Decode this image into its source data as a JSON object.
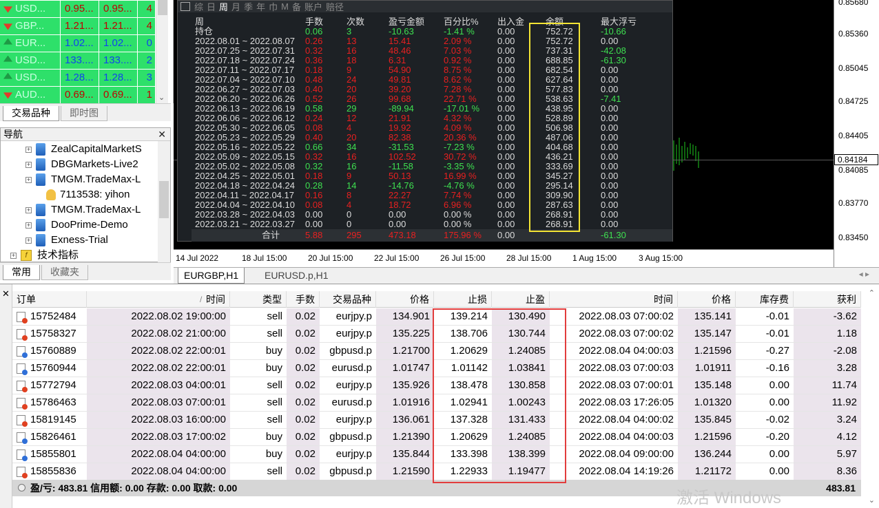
{
  "market_watch": {
    "rows": [
      {
        "symbol": "USD...",
        "bid": "0.95...",
        "ask": "0.95...",
        "spread": "4",
        "dir": "down",
        "bg": "#2ee06a"
      },
      {
        "symbol": "GBP...",
        "bid": "1.21...",
        "ask": "1.21...",
        "spread": "4",
        "dir": "down",
        "bg": "#2ee06a"
      },
      {
        "symbol": "EUR...",
        "bid": "1.02...",
        "ask": "1.02...",
        "spread": "0",
        "dir": "up",
        "bg": "#2ee06a"
      },
      {
        "symbol": "USD...",
        "bid": "133....",
        "ask": "133....",
        "spread": "2",
        "dir": "up",
        "bg": "#2ee06a"
      },
      {
        "symbol": "USD...",
        "bid": "1.28...",
        "ask": "1.28...",
        "spread": "3",
        "dir": "up",
        "bg": "#2ee06a"
      },
      {
        "symbol": "AUD...",
        "bid": "0.69...",
        "ask": "0.69...",
        "spread": "1",
        "dir": "down",
        "bg": "#2ee06a"
      }
    ],
    "tabs": [
      "交易品种",
      "即时图"
    ]
  },
  "navigator": {
    "title": "导航",
    "items": [
      {
        "label": "ZealCapitalMarketS",
        "kind": "server"
      },
      {
        "label": "DBGMarkets-Live2",
        "kind": "server"
      },
      {
        "label": "TMGM.TradeMax-L",
        "kind": "server"
      },
      {
        "label": "7113538: yihon",
        "kind": "user"
      },
      {
        "label": "TMGM.TradeMax-L",
        "kind": "server"
      },
      {
        "label": "DooPrime-Demo",
        "kind": "server"
      },
      {
        "label": "Exness-Trial",
        "kind": "server"
      },
      {
        "label": "技术指标",
        "kind": "indicator"
      }
    ],
    "tabs": [
      "常用",
      "收藏夹"
    ]
  },
  "chart": {
    "prices": [
      "0.85680",
      "0.85360",
      "0.85045",
      "0.84725",
      "0.84405",
      "0.84085",
      "0.83770",
      "0.83450"
    ],
    "current_price": "0.84184",
    "times": [
      "14 Jul 2022",
      "18 Jul 15:00",
      "20 Jul 15:00",
      "22 Jul 15:00",
      "26 Jul 15:00",
      "28 Jul 15:00",
      "1 Aug 15:00",
      "3 Aug 15:00"
    ],
    "tabs": [
      "EURGBP,H1",
      "EURUSD.p,H1"
    ]
  },
  "report": {
    "toolbar": [
      "综",
      "日",
      "周",
      "月",
      "季",
      "年",
      "巾",
      "M",
      "备",
      "账户",
      "赔径"
    ],
    "active_period": "周",
    "headers": {
      "period": "周",
      "lots": "手数",
      "count": "次数",
      "pnl": "盈亏金额",
      "pct": "百分比%",
      "flow": "出入金",
      "balance": "余额",
      "max_float": "最大浮亏"
    },
    "rows": [
      {
        "period": "持仓",
        "lots": "0.06",
        "count": "3",
        "pnl": "-10.63",
        "pct": "-1.41 %",
        "flow": "0.00",
        "balance": "752.72",
        "max_float": "-10.66",
        "sign": "neg"
      },
      {
        "period": "2022.08.01 ~ 2022.08.07",
        "lots": "0.26",
        "count": "13",
        "pnl": "15.41",
        "pct": "2.09 %",
        "flow": "0.00",
        "balance": "752.72",
        "max_float": "0.00",
        "sign": "pos"
      },
      {
        "period": "2022.07.25 ~ 2022.07.31",
        "lots": "0.32",
        "count": "16",
        "pnl": "48.46",
        "pct": "7.03 %",
        "flow": "0.00",
        "balance": "737.31",
        "max_float": "-42.08",
        "sign": "pos"
      },
      {
        "period": "2022.07.18 ~ 2022.07.24",
        "lots": "0.36",
        "count": "18",
        "pnl": "6.31",
        "pct": "0.92 %",
        "flow": "0.00",
        "balance": "688.85",
        "max_float": "-61.30",
        "sign": "pos"
      },
      {
        "period": "2022.07.11 ~ 2022.07.17",
        "lots": "0.18",
        "count": "9",
        "pnl": "54.90",
        "pct": "8.75 %",
        "flow": "0.00",
        "balance": "682.54",
        "max_float": "0.00",
        "sign": "pos"
      },
      {
        "period": "2022.07.04 ~ 2022.07.10",
        "lots": "0.48",
        "count": "24",
        "pnl": "49.81",
        "pct": "8.62 %",
        "flow": "0.00",
        "balance": "627.64",
        "max_float": "0.00",
        "sign": "pos"
      },
      {
        "period": "2022.06.27 ~ 2022.07.03",
        "lots": "0.40",
        "count": "20",
        "pnl": "39.20",
        "pct": "7.28 %",
        "flow": "0.00",
        "balance": "577.83",
        "max_float": "0.00",
        "sign": "pos"
      },
      {
        "period": "2022.06.20 ~ 2022.06.26",
        "lots": "0.52",
        "count": "26",
        "pnl": "99.68",
        "pct": "22.71 %",
        "flow": "0.00",
        "balance": "538.63",
        "max_float": "-7.41",
        "sign": "pos"
      },
      {
        "period": "2022.06.13 ~ 2022.06.19",
        "lots": "0.58",
        "count": "29",
        "pnl": "-89.94",
        "pct": "-17.01 %",
        "flow": "0.00",
        "balance": "438.95",
        "max_float": "0.00",
        "sign": "neg"
      },
      {
        "period": "2022.06.06 ~ 2022.06.12",
        "lots": "0.24",
        "count": "12",
        "pnl": "21.91",
        "pct": "4.32 %",
        "flow": "0.00",
        "balance": "528.89",
        "max_float": "0.00",
        "sign": "pos"
      },
      {
        "period": "2022.05.30 ~ 2022.06.05",
        "lots": "0.08",
        "count": "4",
        "pnl": "19.92",
        "pct": "4.09 %",
        "flow": "0.00",
        "balance": "506.98",
        "max_float": "0.00",
        "sign": "pos"
      },
      {
        "period": "2022.05.23 ~ 2022.05.29",
        "lots": "0.40",
        "count": "20",
        "pnl": "82.38",
        "pct": "20.36 %",
        "flow": "0.00",
        "balance": "487.06",
        "max_float": "0.00",
        "sign": "pos"
      },
      {
        "period": "2022.05.16 ~ 2022.05.22",
        "lots": "0.66",
        "count": "34",
        "pnl": "-31.53",
        "pct": "-7.23 %",
        "flow": "0.00",
        "balance": "404.68",
        "max_float": "0.00",
        "sign": "neg"
      },
      {
        "period": "2022.05.09 ~ 2022.05.15",
        "lots": "0.32",
        "count": "16",
        "pnl": "102.52",
        "pct": "30.72 %",
        "flow": "0.00",
        "balance": "436.21",
        "max_float": "0.00",
        "sign": "pos"
      },
      {
        "period": "2022.05.02 ~ 2022.05.08",
        "lots": "0.32",
        "count": "16",
        "pnl": "-11.58",
        "pct": "-3.35 %",
        "flow": "0.00",
        "balance": "333.69",
        "max_float": "0.00",
        "sign": "neg"
      },
      {
        "period": "2022.04.25 ~ 2022.05.01",
        "lots": "0.18",
        "count": "9",
        "pnl": "50.13",
        "pct": "16.99 %",
        "flow": "0.00",
        "balance": "345.27",
        "max_float": "0.00",
        "sign": "pos"
      },
      {
        "period": "2022.04.18 ~ 2022.04.24",
        "lots": "0.28",
        "count": "14",
        "pnl": "-14.76",
        "pct": "-4.76 %",
        "flow": "0.00",
        "balance": "295.14",
        "max_float": "0.00",
        "sign": "neg"
      },
      {
        "period": "2022.04.11 ~ 2022.04.17",
        "lots": "0.16",
        "count": "8",
        "pnl": "22.27",
        "pct": "7.74 %",
        "flow": "0.00",
        "balance": "309.90",
        "max_float": "0.00",
        "sign": "pos"
      },
      {
        "period": "2022.04.04 ~ 2022.04.10",
        "lots": "0.08",
        "count": "4",
        "pnl": "18.72",
        "pct": "6.96 %",
        "flow": "0.00",
        "balance": "287.63",
        "max_float": "0.00",
        "sign": "pos"
      },
      {
        "period": "2022.03.28 ~ 2022.04.03",
        "lots": "0.00",
        "count": "0",
        "pnl": "0.00",
        "pct": "0.00 %",
        "flow": "0.00",
        "balance": "268.91",
        "max_float": "0.00",
        "sign": "zero"
      },
      {
        "period": "2022.03.21 ~ 2022.03.27",
        "lots": "0.00",
        "count": "0",
        "pnl": "0.00",
        "pct": "0.00 %",
        "flow": "0.00",
        "balance": "268.91",
        "max_float": "0.00",
        "sign": "zero"
      }
    ],
    "total": {
      "label": "合计",
      "lots": "5.88",
      "count": "295",
      "pnl": "473.18",
      "pct": "175.96 %",
      "flow": "0.00",
      "max_float": "-61.30"
    }
  },
  "orders": {
    "headers": [
      "订单",
      "时间",
      "类型",
      "手数",
      "交易品种",
      "价格",
      "止损",
      "止盈",
      "时间",
      "价格",
      "库存费",
      "获利"
    ],
    "rows": [
      [
        "15752484",
        "2022.08.02 19:00:00",
        "sell",
        "0.02",
        "eurjpy.p",
        "134.901",
        "139.214",
        "130.490",
        "2022.08.03 07:00:02",
        "135.141",
        "-0.01",
        "-3.62"
      ],
      [
        "15758327",
        "2022.08.02 21:00:00",
        "sell",
        "0.02",
        "eurjpy.p",
        "135.225",
        "138.706",
        "130.744",
        "2022.08.03 07:00:02",
        "135.147",
        "-0.01",
        "1.18"
      ],
      [
        "15760889",
        "2022.08.02 22:00:01",
        "buy",
        "0.02",
        "gbpusd.p",
        "1.21700",
        "1.20629",
        "1.24085",
        "2022.08.04 04:00:03",
        "1.21596",
        "-0.27",
        "-2.08"
      ],
      [
        "15760944",
        "2022.08.02 22:00:01",
        "buy",
        "0.02",
        "eurusd.p",
        "1.01747",
        "1.01142",
        "1.03841",
        "2022.08.03 07:00:03",
        "1.01911",
        "-0.16",
        "3.28"
      ],
      [
        "15772794",
        "2022.08.03 04:00:01",
        "sell",
        "0.02",
        "eurjpy.p",
        "135.926",
        "138.478",
        "130.858",
        "2022.08.03 07:00:01",
        "135.148",
        "0.00",
        "11.74"
      ],
      [
        "15786463",
        "2022.08.03 07:00:01",
        "sell",
        "0.02",
        "eurusd.p",
        "1.01916",
        "1.02941",
        "1.00243",
        "2022.08.03 17:26:05",
        "1.01320",
        "0.00",
        "11.92"
      ],
      [
        "15819145",
        "2022.08.03 16:00:00",
        "sell",
        "0.02",
        "eurjpy.p",
        "136.061",
        "137.328",
        "131.433",
        "2022.08.04 04:00:02",
        "135.845",
        "-0.02",
        "3.24"
      ],
      [
        "15826461",
        "2022.08.03 17:00:02",
        "buy",
        "0.02",
        "gbpusd.p",
        "1.21390",
        "1.20629",
        "1.24085",
        "2022.08.04 04:00:03",
        "1.21596",
        "-0.20",
        "4.12"
      ],
      [
        "15855801",
        "2022.08.04 04:00:00",
        "buy",
        "0.02",
        "eurjpy.p",
        "135.844",
        "133.398",
        "138.399",
        "2022.08.04 09:00:00",
        "136.244",
        "0.00",
        "5.97"
      ],
      [
        "15855836",
        "2022.08.04 04:00:00",
        "sell",
        "0.02",
        "gbpusd.p",
        "1.21590",
        "1.22933",
        "1.19477",
        "2022.08.04 14:19:26",
        "1.21172",
        "0.00",
        "8.36"
      ]
    ],
    "summary": "盈/亏: 483.81  信用额: 0.00  存款: 0.00  取款: 0.00",
    "summary_total": "483.81"
  },
  "watermark": "激活 Windows",
  "colors": {
    "green": "#3ee050",
    "red": "#e82020",
    "highlight_yellow": "#f5e634",
    "highlight_red": "#e23c3c"
  }
}
